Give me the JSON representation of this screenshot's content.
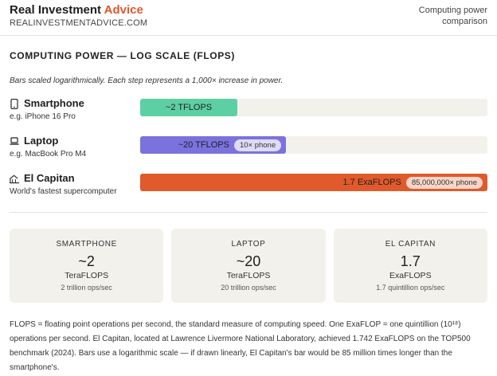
{
  "header": {
    "brand_main": "Real Investment",
    "brand_accent": "Advice",
    "url": "REALINVESTMENTADVICE.COM",
    "note": "Computing power comparison"
  },
  "section_title": "COMPUTING POWER — LOG SCALE (FLOPS)",
  "subtitle": "Bars scaled logarithmically. Each step represents a 1,000× increase in power.",
  "chart_data": {
    "type": "bar",
    "scale": "log",
    "categories": [
      "Smartphone",
      "Laptop",
      "El Capitan"
    ],
    "values": [
      2000000000000.0,
      20000000000000.0,
      1.742e+18
    ],
    "bar_fraction": [
      0.28,
      0.42,
      1.0
    ],
    "colors": [
      "#5dcfa5",
      "#7b72de",
      "#e05a2b"
    ]
  },
  "rows": [
    {
      "name": "Smartphone",
      "sub": "e.g. iPhone 16 Pro",
      "icon": "smartphone-icon",
      "value_label": "~2 TFLOPS",
      "pill": ""
    },
    {
      "name": "Laptop",
      "sub": "e.g. MacBook Pro M4",
      "icon": "laptop-icon",
      "value_label": "~20 TFLOPS",
      "pill": "10× phone"
    },
    {
      "name": "El Capitan",
      "sub": "World's fastest supercomputer",
      "icon": "building-icon",
      "value_label": "1.7 ExaFLOPS",
      "pill": "85,000,000× phone"
    }
  ],
  "cards": [
    {
      "label": "SMARTPHONE",
      "value": "~2",
      "unit": "TeraFLOPS",
      "ops": "2 trillion ops/sec"
    },
    {
      "label": "LAPTOP",
      "value": "~20",
      "unit": "TeraFLOPS",
      "ops": "20 trillion ops/sec"
    },
    {
      "label": "EL CAPITAN",
      "value": "1.7",
      "unit": "ExaFLOPS",
      "ops": "1.7 quintillion ops/sec"
    }
  ],
  "footnote": "FLOPS = floating point operations per second, the standard measure of computing speed. One ExaFLOP = one quintillion (10¹⁸) operations per second. El Capitan, located at Lawrence Livermore National Laboratory, achieved 1.742 ExaFLOPS on the TOP500 benchmark (2024). Bars use a logarithmic scale — if drawn linearly, El Capitan's bar would be 85 million times longer than the smartphone's."
}
